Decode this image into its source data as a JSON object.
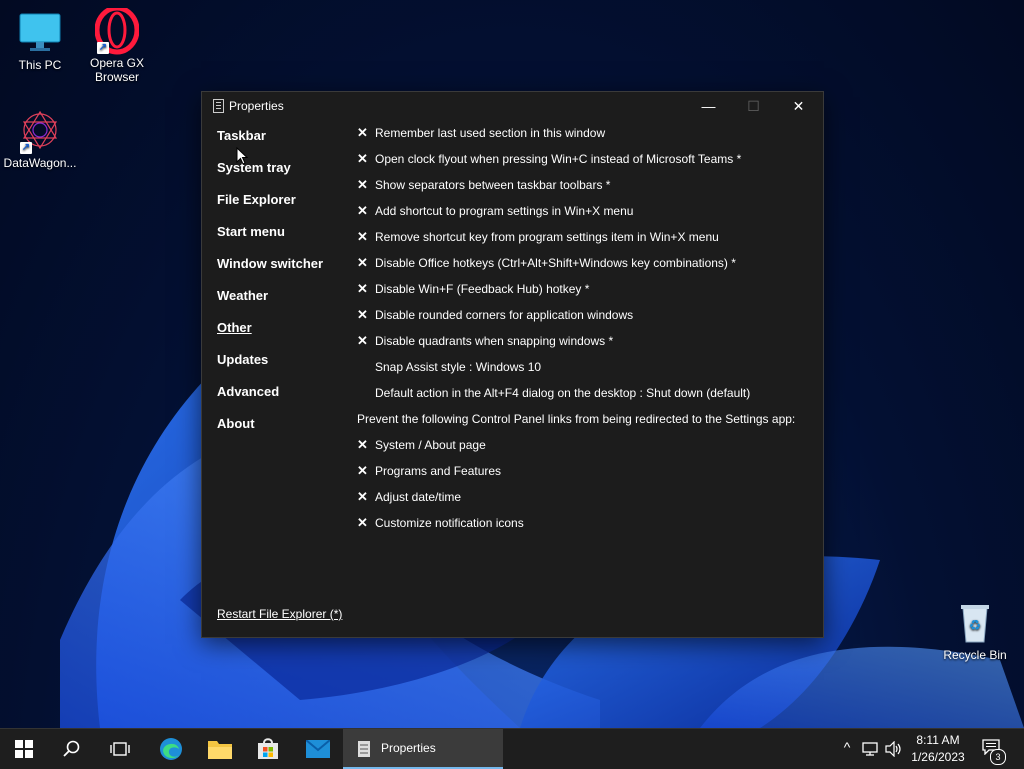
{
  "desktop": {
    "icons": [
      {
        "label": "This PC",
        "icon": "monitor-icon"
      },
      {
        "label": "Opera GX Browser",
        "label_line1": "Opera GX",
        "label_line2": "Browser",
        "icon": "opera-gx-icon"
      },
      {
        "label": "DataWagon...",
        "icon": "datawagon-icon"
      },
      {
        "label": "Recycle Bin",
        "icon": "recycle-bin-icon"
      }
    ]
  },
  "window": {
    "title": "Properties",
    "controls": {
      "minimize": "—",
      "maximize": "☐",
      "close": "✕"
    },
    "nav": [
      {
        "label": "Taskbar",
        "active": false
      },
      {
        "label": "System tray",
        "active": false
      },
      {
        "label": "File Explorer",
        "active": false
      },
      {
        "label": "Start menu",
        "active": false
      },
      {
        "label": "Window switcher",
        "active": false
      },
      {
        "label": "Weather",
        "active": false
      },
      {
        "label": "Other",
        "active": true
      },
      {
        "label": "Updates",
        "active": false
      },
      {
        "label": "Advanced",
        "active": false
      },
      {
        "label": "About",
        "active": false
      }
    ],
    "options": [
      {
        "mark": "✕",
        "text": "Remember last used section in this window"
      },
      {
        "mark": "✕",
        "text": "Open clock flyout when pressing Win+C instead of Microsoft Teams *"
      },
      {
        "mark": "✕",
        "text": "Show separators between taskbar toolbars *"
      },
      {
        "mark": "✕",
        "text": "Add shortcut to program settings in Win+X menu"
      },
      {
        "mark": "✕",
        "text": "Remove shortcut key from program settings item in Win+X menu"
      },
      {
        "mark": "✕",
        "text": "Disable Office hotkeys (Ctrl+Alt+Shift+Windows key combinations) *"
      },
      {
        "mark": "✕",
        "text": "Disable Win+F (Feedback Hub) hotkey *"
      },
      {
        "mark": "✕",
        "text": "Disable rounded corners for application windows"
      },
      {
        "mark": "✕",
        "text": "Disable quadrants when snapping windows *"
      },
      {
        "mark": "",
        "text": "Snap Assist style : Windows 10"
      },
      {
        "mark": "",
        "text": "Default action in the Alt+F4 dialog on the desktop : Shut down (default)"
      }
    ],
    "redirect_heading": "Prevent the following Control Panel links from being redirected to the Settings app:",
    "redirect_options": [
      {
        "mark": "✕",
        "text": "System / About page"
      },
      {
        "mark": "✕",
        "text": "Programs and Features"
      },
      {
        "mark": "✕",
        "text": "Adjust date/time"
      },
      {
        "mark": "✕",
        "text": "Customize notification icons"
      }
    ],
    "restart_link": "Restart File Explorer (*)"
  },
  "taskbar": {
    "pinned": [
      "start-icon",
      "search-icon",
      "task-view-icon",
      "edge-icon",
      "file-explorer-icon",
      "store-icon",
      "mail-icon"
    ],
    "active_task": {
      "label": "Properties"
    },
    "tray": {
      "chevron": "^",
      "time": "8:11 AM",
      "date": "1/26/2023",
      "notification_count": "3"
    }
  },
  "colors": {
    "accent": "#76b9ed",
    "window_bg": "#1c1c1c",
    "taskbar_bg": "#1e1e1e"
  }
}
